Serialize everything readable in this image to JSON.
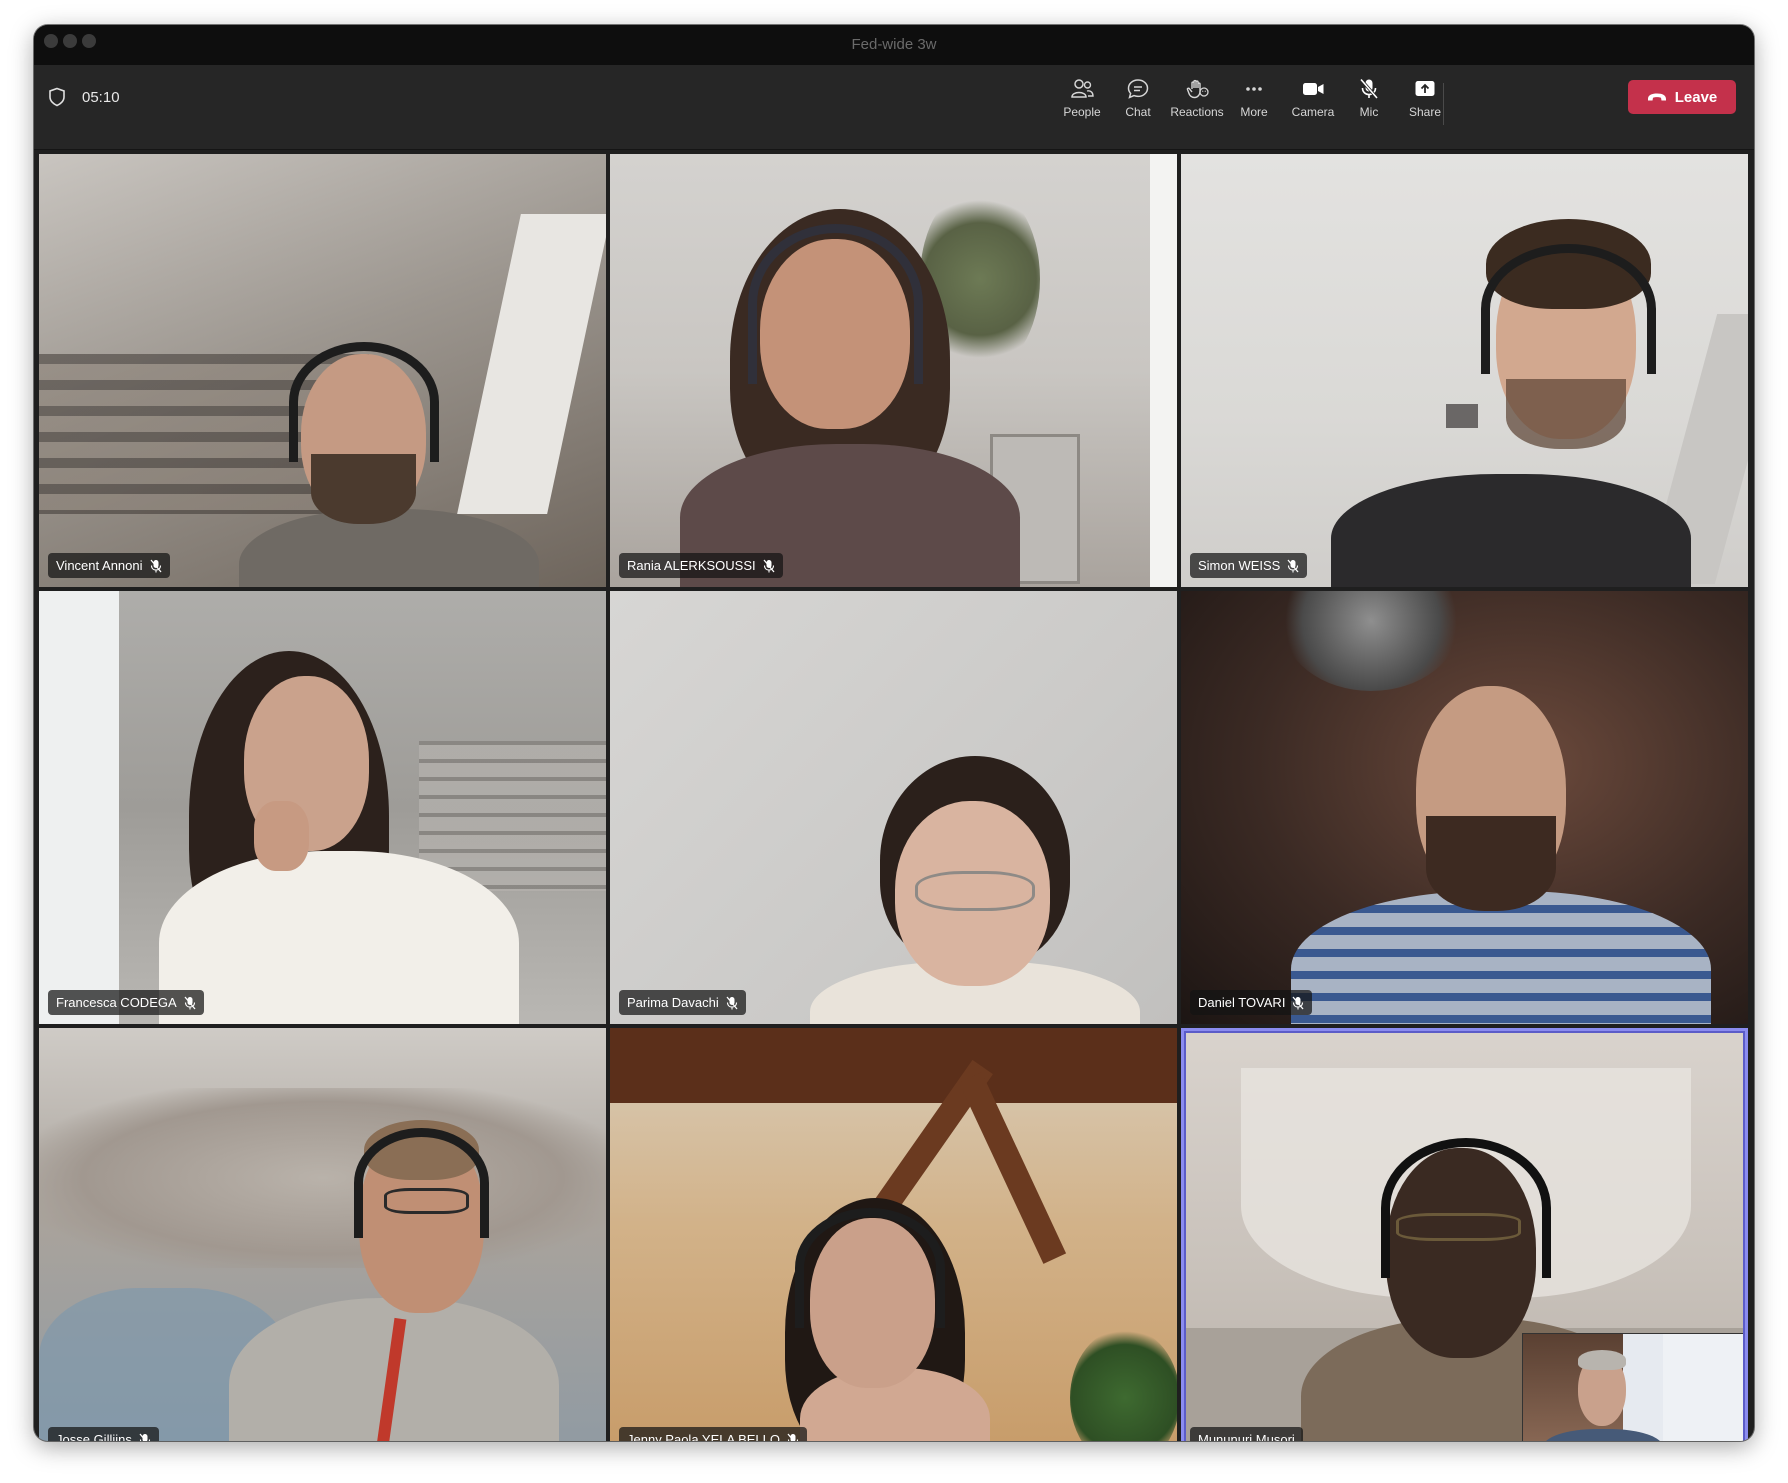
{
  "window": {
    "title": "Fed-wide 3w"
  },
  "toolbar": {
    "timer": "05:10",
    "buttons": [
      {
        "label": "People",
        "icon": "people-icon"
      },
      {
        "label": "Chat",
        "icon": "chat-icon"
      },
      {
        "label": "Reactions",
        "icon": "reactions-icon"
      },
      {
        "label": "More",
        "icon": "more-icon"
      },
      {
        "label": "Camera",
        "icon": "camera-icon"
      },
      {
        "label": "Mic",
        "icon": "mic-off-icon"
      },
      {
        "label": "Share",
        "icon": "share-icon"
      }
    ],
    "leave_label": "Leave"
  },
  "participants": [
    {
      "name": "Vincent Annoni",
      "muted": true
    },
    {
      "name": "Rania ALERKSOUSSI",
      "muted": true
    },
    {
      "name": "Simon WEISS",
      "muted": true
    },
    {
      "name": "Francesca CODEGA",
      "muted": true
    },
    {
      "name": "Parima Davachi",
      "muted": true
    },
    {
      "name": "Daniel TOVARI",
      "muted": true
    },
    {
      "name": "Josse Gillijns",
      "muted": true
    },
    {
      "name": "Jenny Paola YELA BELLO",
      "muted": true
    },
    {
      "name": "Mununuri Musori",
      "muted": false,
      "active_speaker": true
    }
  ],
  "colors": {
    "leave": "#c4314b",
    "active_speaker_ring": "#8b8cf0"
  }
}
